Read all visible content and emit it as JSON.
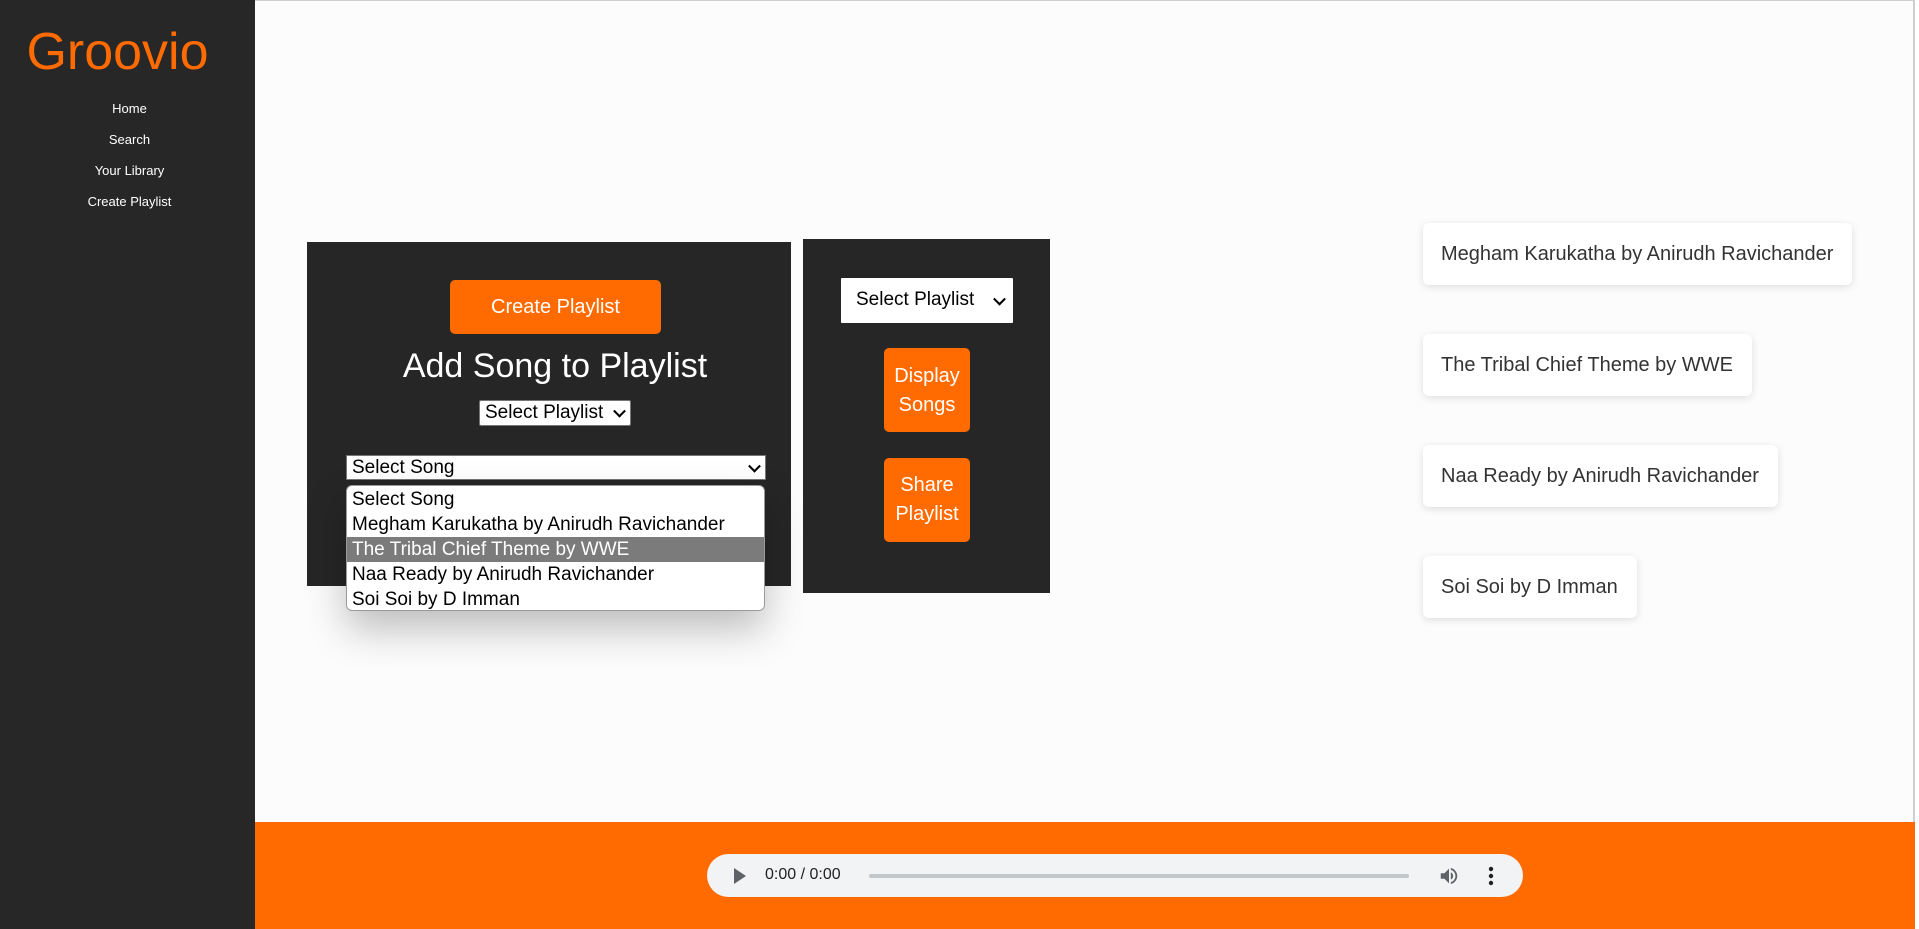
{
  "app": {
    "logo": "Groovio",
    "accent": "#ff6b00",
    "sidebar_bg": "#272727"
  },
  "sidebar": {
    "items": [
      {
        "label": "Home"
      },
      {
        "label": "Search"
      },
      {
        "label": "Your Library"
      },
      {
        "label": "Create Playlist"
      }
    ]
  },
  "create_panel": {
    "create_button": "Create Playlist",
    "title": "Add Song to Playlist",
    "playlist_select": "Select Playlist",
    "song_select": "Select Song",
    "song_options": [
      {
        "label": "Select Song",
        "selected": false
      },
      {
        "label": "Megham Karukatha by Anirudh Ravichander",
        "selected": false
      },
      {
        "label": "The Tribal Chief Theme by WWE",
        "selected": true
      },
      {
        "label": "Naa Ready by Anirudh Ravichander",
        "selected": false
      },
      {
        "label": "Soi Soi by D Imman",
        "selected": false
      }
    ]
  },
  "playlist_panel": {
    "playlist_select": "Select Playlist",
    "display_button": [
      "Display",
      "Songs"
    ],
    "share_button": [
      "Share",
      "Playlist"
    ]
  },
  "song_list": [
    {
      "label": "Megham Karukatha by Anirudh Ravichander"
    },
    {
      "label": "The Tribal Chief Theme by WWE"
    },
    {
      "label": "Naa Ready by Anirudh Ravichander"
    },
    {
      "label": "Soi Soi by D Imman"
    }
  ],
  "player": {
    "time": "0:00 / 0:00",
    "icons": [
      "play-icon",
      "volume-icon",
      "more-options-icon"
    ]
  }
}
